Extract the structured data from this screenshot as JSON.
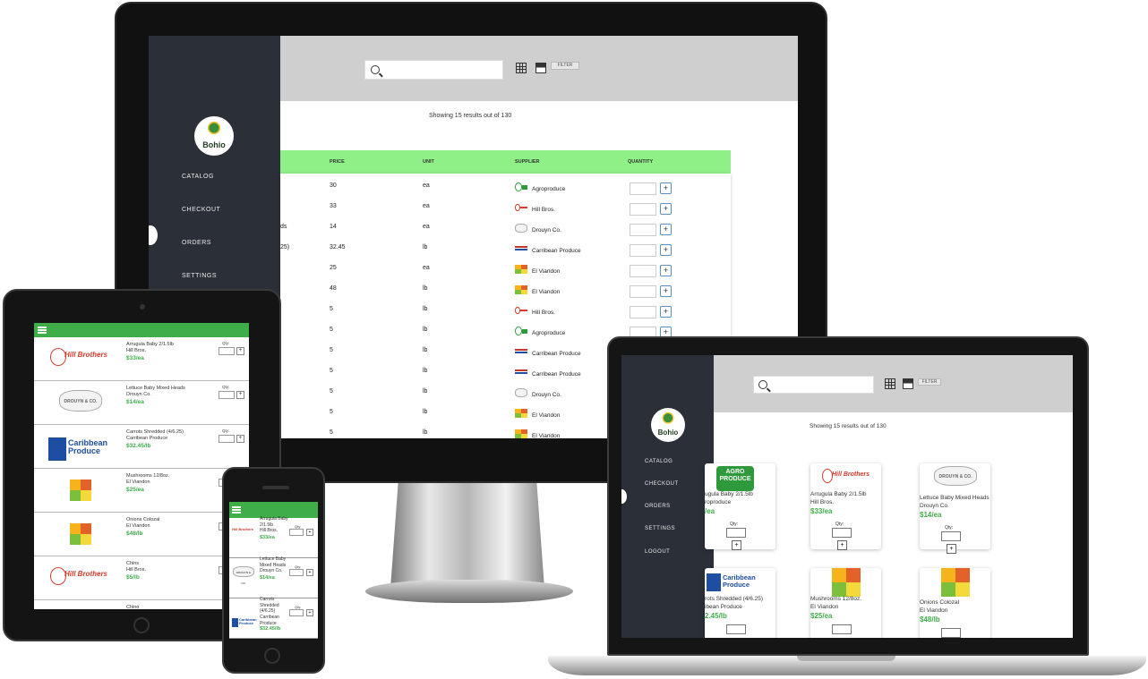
{
  "brand": {
    "logo_text": "Bohio"
  },
  "nav": {
    "catalog": "CATALOG",
    "checkout": "CHECKOUT",
    "orders": "ORDERS",
    "settings": "SETTINGS",
    "logout": "LOGOUT"
  },
  "toolbar": {
    "filter_label": "FILTER",
    "search_placeholder": ""
  },
  "results_text": "Showing 15 results out of 130",
  "table": {
    "headers": {
      "price": "PRICE",
      "unit": "UNIT",
      "supplier": "SUPPLIER",
      "quantity": "QUANTITY"
    },
    "rows": [
      {
        "name_fragment": "",
        "price": "30",
        "unit": "ea",
        "supplier": "Agroproduce",
        "supplier_logo": "agro-produce-logo"
      },
      {
        "name_fragment": "",
        "price": "33",
        "unit": "ea",
        "supplier": "Hill Bros.",
        "supplier_logo": "hill-brothers-logo"
      },
      {
        "name_fragment": "ds",
        "price": "14",
        "unit": "ea",
        "supplier": "Drouyn Co.",
        "supplier_logo": "drouyn-logo"
      },
      {
        "name_fragment": "25)",
        "price": "32.45",
        "unit": "lb",
        "supplier": "Carribean Produce",
        "supplier_logo": "caribbean-produce-logo"
      },
      {
        "name_fragment": "",
        "price": "25",
        "unit": "ea",
        "supplier": "El Viandon",
        "supplier_logo": "el-viandon-logo"
      },
      {
        "name_fragment": "",
        "price": "48",
        "unit": "lb",
        "supplier": "El Viandon",
        "supplier_logo": "el-viandon-logo"
      },
      {
        "name_fragment": "",
        "price": "5",
        "unit": "lb",
        "supplier": "Hill Bros.",
        "supplier_logo": "hill-brothers-logo"
      },
      {
        "name_fragment": "",
        "price": "5",
        "unit": "lb",
        "supplier": "Agroproduce",
        "supplier_logo": "agro-produce-logo"
      },
      {
        "name_fragment": "",
        "price": "5",
        "unit": "lb",
        "supplier": "Carribean Produce",
        "supplier_logo": "caribbean-produce-logo"
      },
      {
        "name_fragment": "",
        "price": "5",
        "unit": "lb",
        "supplier": "Carribean Produce",
        "supplier_logo": "caribbean-produce-logo"
      },
      {
        "name_fragment": "",
        "price": "5",
        "unit": "lb",
        "supplier": "Drouyn Co.",
        "supplier_logo": "drouyn-logo"
      },
      {
        "name_fragment": "",
        "price": "5",
        "unit": "lb",
        "supplier": "El Viandon",
        "supplier_logo": "el-viandon-logo"
      },
      {
        "name_fragment": "",
        "price": "5",
        "unit": "lb",
        "supplier": "El Viandon",
        "supplier_logo": "el-viandon-logo"
      }
    ],
    "plus_label": "+"
  },
  "tablet_items": [
    {
      "name": "Arrugula Baby 2/1.5lb",
      "supplier": "Hill Bros.",
      "price": "$33/ea",
      "qty_label": "Qty:",
      "logo_text": "Hill Brothers"
    },
    {
      "name": "Lettuce Baby Mixed Heads",
      "supplier": "Drouyn Co.",
      "price": "$14/ea",
      "qty_label": "Qty:",
      "logo_text": "DROUYN & CO."
    },
    {
      "name": "Carrots Shredded (4/6.25)",
      "supplier": "Carribean Produce",
      "price": "$32.45/lb",
      "qty_label": "Qty:",
      "logo_text": "Caribbean Produce"
    },
    {
      "name": "Mushrooms 12/8oz.",
      "supplier": "El Viandon",
      "price": "$25/ea",
      "qty_label": "",
      "logo_text": ""
    },
    {
      "name": "Onions Colozal",
      "supplier": "El Viandon",
      "price": "$48/lb",
      "qty_label": "",
      "logo_text": ""
    },
    {
      "name": "Chins",
      "supplier": "Hill Bros.",
      "price": "$5/lb",
      "qty_label": "",
      "logo_text": "Hill Brothers"
    },
    {
      "name": "Chino",
      "supplier": "",
      "price": "",
      "qty_label": "",
      "logo_text": ""
    }
  ],
  "phone_items": [
    {
      "name": "Arrugula Baby 2/1.5lb",
      "supplier": "Hill Bros.",
      "price": "$33/ea",
      "qty_label": "Qty:",
      "logo_text": "Hill Brothers"
    },
    {
      "name": "Lettuce Baby Mixed Heads",
      "supplier": "Drouyn Co.",
      "price": "$14/ea",
      "qty_label": "Qty:",
      "logo_text": "DROUYN & CO."
    },
    {
      "name": "Carrots Shredded (4/6.25)",
      "supplier": "Carribean Produce",
      "price": "$32.45/lb",
      "qty_label": "Qty:",
      "logo_text": "Caribbean Produce"
    }
  ],
  "laptop_cards": [
    {
      "name": "ugula Baby 2/1.5lb",
      "supplier": "roproduce",
      "price": "/ea",
      "qty_label": "Qty:",
      "logo_text": "AGRO PRODUCE"
    },
    {
      "name": "Arrugula Baby 2/1.5lb",
      "supplier": "Hill Bros.",
      "price": "$33/ea",
      "qty_label": "Qty:",
      "logo_text": "Hill Brothers"
    },
    {
      "name": "Lettuce Baby Mixed Heads",
      "supplier": "Drouyn Co.",
      "price": "$14/ea",
      "qty_label": "Qty:",
      "logo_text": "DROUYN & CO."
    },
    {
      "name": "rots Shredded (4/6.25)",
      "supplier": "ibean Produce",
      "price": "2.45/lb",
      "qty_label": "",
      "logo_text": "Caribbean Produce"
    },
    {
      "name": "Mushrooms 12/8oz.",
      "supplier": "El Viandon",
      "price": "$25/ea",
      "qty_label": "",
      "logo_text": ""
    },
    {
      "name": "Onions Colozal",
      "supplier": "El Viandon",
      "price": "$48/lb",
      "qty_label": "",
      "logo_text": ""
    }
  ],
  "colors": {
    "accent_green": "#3fae49",
    "sidebar": "#2b2f38",
    "header_green": "#8ef086",
    "topbar_gray": "#cfcfcf"
  }
}
